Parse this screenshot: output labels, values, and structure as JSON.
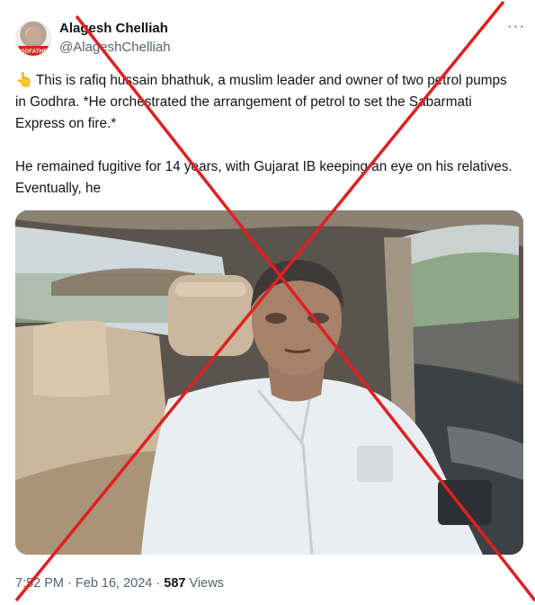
{
  "author": {
    "display_name": "Alagesh Chelliah",
    "handle": "@AlageshChelliah",
    "avatar_badge_text": "GODFATHER"
  },
  "more_icon": "more-horizontal-icon",
  "tweet": {
    "pointer_icon": "👆",
    "text": "This is rafiq hussain bhathuk, a muslim leader and owner of two petrol pumps in Godhra. *He orchestrated the arrangement of petrol to set the Sabarmati Express on fire.*\n\nHe remained fugitive for 14 years, with Gujarat IB keeping an eye on his relatives. Eventually, he"
  },
  "media": {
    "kind": "photo",
    "subject": "man in white shirt seated in back of car"
  },
  "footer": {
    "time": "7:52 PM",
    "separator": "·",
    "date": "Feb 16, 2024",
    "views_count": "587",
    "views_label": "Views"
  },
  "overlay": {
    "type": "red-x-cross",
    "color": "#e02020"
  }
}
